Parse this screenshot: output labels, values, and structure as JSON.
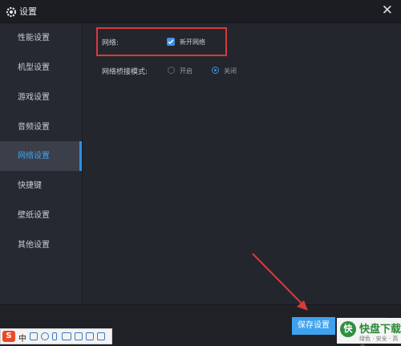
{
  "window": {
    "title": "设置",
    "close_glyph": "✕"
  },
  "sidebar": {
    "items": [
      {
        "label": "性能设置",
        "active": false
      },
      {
        "label": "机型设置",
        "active": false
      },
      {
        "label": "游戏设置",
        "active": false
      },
      {
        "label": "音频设置",
        "active": false
      },
      {
        "label": "网络设置",
        "active": true
      },
      {
        "label": "快捷键",
        "active": false
      },
      {
        "label": "壁纸设置",
        "active": false
      },
      {
        "label": "其他设置",
        "active": false
      }
    ]
  },
  "network": {
    "label": "网络:",
    "enable_checkbox": {
      "label": "新开网络",
      "checked": true
    },
    "bridge_mode": {
      "label": "网络桥接模式:",
      "options": [
        {
          "label": "开启",
          "selected": false
        },
        {
          "label": "关闭",
          "selected": true
        }
      ]
    }
  },
  "footer": {
    "save_label": "保存设置"
  },
  "ime": {
    "logo": "S",
    "mode": "中"
  },
  "watermark": {
    "logo": "快",
    "main": "快盘下载",
    "sub": "绿色 · 安全 · 高速"
  },
  "colors": {
    "accent": "#3ea1ee",
    "highlight_box": "#d83a3a",
    "bg": "#23262d"
  },
  "icons": [
    "gear-icon",
    "close-icon",
    "checkmark-icon",
    "sogou-ime-icon"
  ]
}
